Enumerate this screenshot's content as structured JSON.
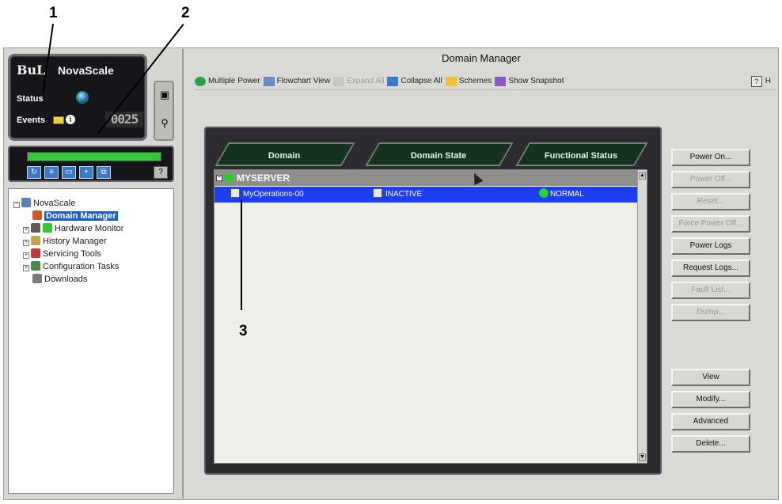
{
  "callouts": {
    "c1": "1",
    "c2": "2",
    "c3": "3"
  },
  "brand": {
    "logo": "BuL",
    "name": "NovaScale",
    "status_label": "Status",
    "events_label": "Events",
    "events_counter": "0025"
  },
  "heartbeat": {
    "level_percent": 100
  },
  "tree": {
    "items": [
      {
        "label": "NovaScale",
        "icon": "server-icon"
      },
      {
        "label": "Domain Manager",
        "icon": "domain-manager-icon",
        "selected": true
      },
      {
        "label": "Hardware Monitor",
        "icon": "hardware-monitor-icon"
      },
      {
        "label": "History Manager",
        "icon": "history-manager-icon"
      },
      {
        "label": "Servicing Tools",
        "icon": "servicing-tools-icon"
      },
      {
        "label": "Configuration Tasks",
        "icon": "configuration-tasks-icon"
      },
      {
        "label": "Downloads",
        "icon": "downloads-icon"
      }
    ]
  },
  "main": {
    "title": "Domain Manager",
    "toolbar": {
      "multiple_power": "Multiple Power",
      "flowchart_view": "Flowchart View",
      "expand_all": "Expand All",
      "collapse_all": "Collapse All",
      "schemes": "Schemes",
      "show_snapshot": "Show Snapshot",
      "help": "H"
    },
    "tabs": {
      "domain": "Domain",
      "domain_state": "Domain State",
      "functional_status": "Functional Status"
    },
    "group": {
      "name": "MYSERVER"
    },
    "row": {
      "domain": "MyOperations-00",
      "state": "INACTIVE",
      "status": "NORMAL"
    },
    "actions": {
      "power_on": "Power On...",
      "power_off": "Power Off...",
      "reset": "Reset...",
      "force_power_off": "Force Power Off...",
      "power_logs": "Power Logs",
      "request_logs": "Request Logs...",
      "fault_list": "Fault List...",
      "dump": "Dump...",
      "view": "View",
      "modify": "Modify...",
      "advanced": "Advanced",
      "delete": "Delete..."
    }
  },
  "colors": {
    "accent": "#1d3ef0",
    "status_ok": "#2ad02a",
    "tab_bg": "#153220"
  }
}
